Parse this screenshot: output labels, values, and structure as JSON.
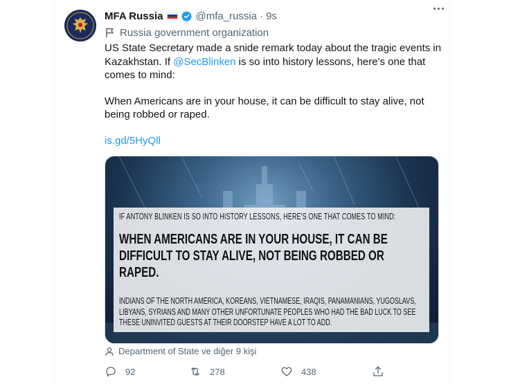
{
  "tweet": {
    "author": {
      "display_name": "MFA Russia",
      "handle": "@mfa_russia",
      "flag": "russia-flag",
      "verified": true
    },
    "separator": "·",
    "time": "9s",
    "org_label": "Russia government organization",
    "text": {
      "line1_prefix": "US State Secretary made a snide remark today about the tragic events in Kazakhstan. If ",
      "mention": "@SecBlinken",
      "line1_suffix": " is so into history lessons, here's one that comes to mind:",
      "paragraph2": "When Americans are in your house, it can be difficult to stay alive, not being robbed or raped.",
      "link": "is.gd/5HyQll"
    },
    "media": {
      "line1": "IF ANTONY BLINKEN IS SO INTO HISTORY LESSONS, HERE'S ONE THAT COMES TO MIND:",
      "line2": "WHEN AMERICANS ARE IN YOUR HOUSE, IT CAN BE DIFFICULT TO STAY ALIVE, NOT BEING ROBBED OR RAPED.",
      "line3": "INDIANS OF THE NORTH AMERICA, KOREANS, VIETNAMESE, IRAQIS, PANAMANIANS, YUGOSLAVS, LIBYANS, SYRIANS AND MANY OTHER UNFORTUNATE PEOPLES WHO HAD THE BAD LUCK TO SEE THESE UNINVITED GUESTS AT THEIR DOORSTEP HAVE A LOT TO ADD."
    },
    "tagged": "Department of State ve diğer 9 kişi",
    "actions": {
      "reply_count": "92",
      "retweet_count": "278",
      "like_count": "438"
    }
  },
  "colors": {
    "accent": "#1d9bf0",
    "secondary_text": "#536471",
    "primary_text": "#0f1419",
    "flag_white": "#ffffff",
    "flag_blue": "#0039a6",
    "flag_red": "#d52b1e"
  }
}
